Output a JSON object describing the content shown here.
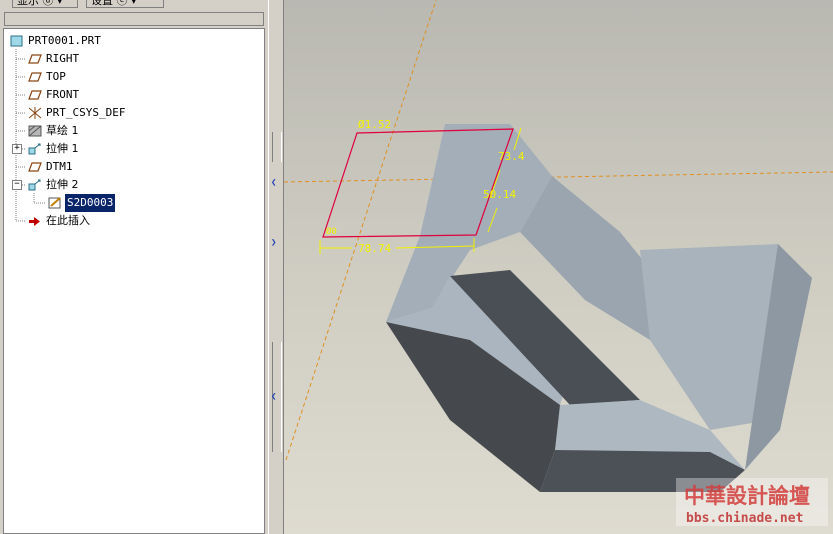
{
  "menu": {
    "display_label": "显示 ⓓ ▾",
    "settings_label": "设置 ⓔ ▾"
  },
  "tree": {
    "items": [
      {
        "label": "PRT0001.PRT",
        "icon": "part-icon"
      },
      {
        "label": "RIGHT",
        "icon": "datum-plane-icon"
      },
      {
        "label": "TOP",
        "icon": "datum-plane-icon"
      },
      {
        "label": "FRONT",
        "icon": "datum-plane-icon"
      },
      {
        "label": "PRT_CSYS_DEF",
        "icon": "csys-icon"
      },
      {
        "label": "草绘 1",
        "icon": "sketch-icon"
      },
      {
        "label": "拉伸 1",
        "icon": "extrude-icon"
      },
      {
        "label": "DTM1",
        "icon": "datum-plane-icon"
      },
      {
        "label": "拉伸 2",
        "icon": "extrude-icon"
      },
      {
        "label": "S2D0003",
        "icon": "section-sketch-icon"
      },
      {
        "label": "在此插入",
        "icon": "insert-here-arrow-icon"
      }
    ]
  },
  "viewport": {
    "dimensions": {
      "d1": "Ø1.52",
      "d2": "73.4",
      "d3": "50.14",
      "d4": "78.74",
      "d5": "Ø0"
    },
    "colors": {
      "sketch": "#e0003c",
      "dimension": "#f2f200",
      "datum_axis": "#e09020",
      "face_light": "#a9b3bc",
      "face_dark": "#4a4f55"
    }
  },
  "watermark": {
    "title": "中華設計論壇",
    "url": "bbs.chinade.net"
  }
}
